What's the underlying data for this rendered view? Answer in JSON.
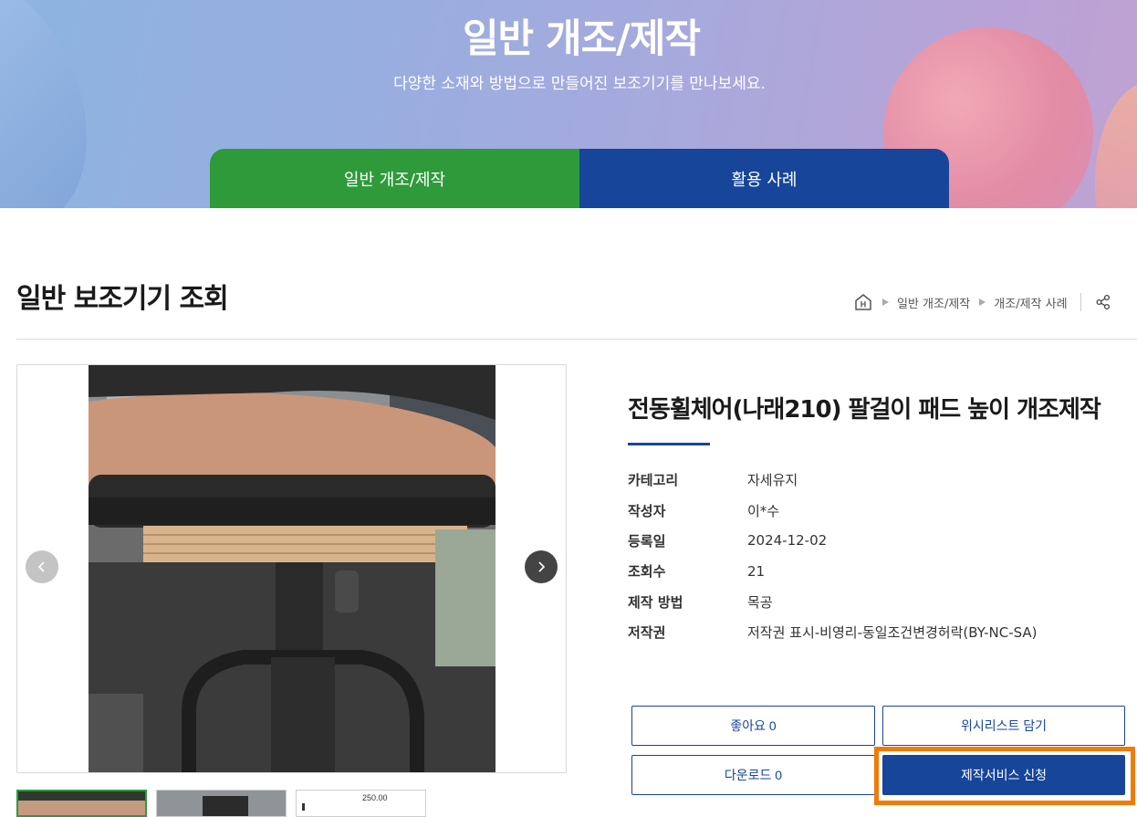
{
  "hero": {
    "title": "일반 개조/제작",
    "subtitle": "다양한 소재와 방법으로 만들어진 보조기기를 만나보세요."
  },
  "tabs": [
    {
      "label": "일반 개조/제작",
      "active": true,
      "color": "#2e9a3a"
    },
    {
      "label": "활용 사례",
      "active": false,
      "color": "#17459a"
    }
  ],
  "page": {
    "title": "일반 보조기기 조회"
  },
  "breadcrumb": {
    "home_icon": "home-icon",
    "items": [
      "일반 개조/제작",
      "개조/제작 사례"
    ],
    "share_icon": "share-icon"
  },
  "gallery": {
    "prev_icon": "chevron-left-icon",
    "next_icon": "chevron-right-icon",
    "thumbnail_text": "250.00"
  },
  "post": {
    "title": "전동휠체어(나래210) 팔걸이 패드 높이 개조제작",
    "meta": [
      {
        "label": "카테고리",
        "value": "자세유지"
      },
      {
        "label": "작성자",
        "value": "이*수"
      },
      {
        "label": "등록일",
        "value": "2024-12-02"
      },
      {
        "label": "조회수",
        "value": "21"
      },
      {
        "label": "제작 방법",
        "value": "목공"
      },
      {
        "label": "저작권",
        "value": "저작권 표시-비영리-동일조건변경허락(BY-NC-SA)"
      }
    ]
  },
  "actions": {
    "like": "좋아요 0",
    "wishlist": "위시리스트 담기",
    "download": "다운로드 0",
    "apply": "제작서비스 신청"
  },
  "colors": {
    "primary": "#17459a",
    "green": "#2e9a3a",
    "highlight": "#f07a0a"
  }
}
